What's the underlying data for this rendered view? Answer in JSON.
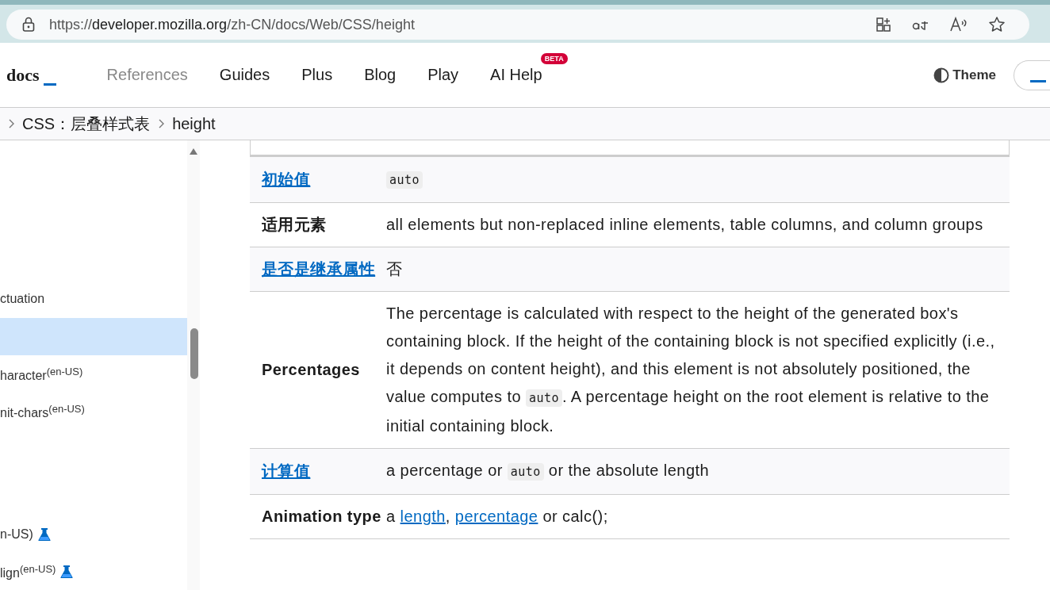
{
  "browser": {
    "url": {
      "scheme": "https://",
      "domain": "developer.mozilla.org",
      "path": "/zh-CN/docs/Web/CSS/height"
    }
  },
  "header": {
    "logo": "docs",
    "nav": [
      {
        "label": "References",
        "selected": true
      },
      {
        "label": "Guides",
        "selected": false
      },
      {
        "label": "Plus",
        "selected": false
      },
      {
        "label": "Blog",
        "selected": false
      },
      {
        "label": "Play",
        "selected": false
      },
      {
        "label": "AI Help",
        "selected": false,
        "badge": "BETA"
      }
    ],
    "theme": "Theme"
  },
  "breadcrumbs": [
    "CSS：层叠样式表",
    "height"
  ],
  "sidebar": {
    "items": [
      {
        "label": "ctuation",
        "selected": false,
        "experimental": false
      },
      {
        "selected": true,
        "experimental": false
      },
      {
        "label": "haracter$^{(en-US)}$",
        "selected": false,
        "experimental": false
      },
      {
        "label": "nit-chars$^{(en-US)}$",
        "selected": false,
        "experimental": false
      },
      {
        "label": "n-US)",
        "selected": false,
        "experimental": true
      },
      {
        "label": "lign$^{(en-US)}$",
        "selected": false,
        "experimental": true
      }
    ]
  },
  "table": {
    "rows": [
      {
        "name": "初始值",
        "link": true,
        "value": [
          {
            "kind": "code",
            "text": "auto"
          }
        ]
      },
      {
        "name": "适用元素",
        "link": false,
        "value": [
          {
            "kind": "text",
            "text": "all elements but non-replaced inline elements, table columns, and column groups"
          }
        ]
      },
      {
        "name": "是否是继承属性",
        "link": true,
        "value": [
          {
            "kind": "text",
            "text": "否"
          }
        ]
      },
      {
        "name": "Percentages",
        "link": false,
        "value": [
          {
            "kind": "text",
            "text": "The percentage is calculated with respect to the height of the generated box's containing block. If the height of the containing block is not specified explicitly (i.e., it depends on content height), and this element is not absolutely positioned, the value computes to "
          },
          {
            "kind": "code",
            "text": "auto"
          },
          {
            "kind": "text",
            "text": ". A percentage height on the root element is relative to the initial containing block."
          }
        ]
      },
      {
        "name": "计算值",
        "link": true,
        "value": [
          {
            "kind": "text",
            "text": "a percentage or "
          },
          {
            "kind": "code",
            "text": "auto"
          },
          {
            "kind": "text",
            "text": " or the absolute length"
          }
        ]
      },
      {
        "name": "Animation type",
        "link": false,
        "value": [
          {
            "kind": "text",
            "text": "a "
          },
          {
            "kind": "link",
            "text": "length"
          },
          {
            "kind": "text",
            "text": ", "
          },
          {
            "kind": "link",
            "text": "percentage"
          },
          {
            "kind": "text",
            "text": " or calc();"
          }
        ]
      }
    ]
  }
}
